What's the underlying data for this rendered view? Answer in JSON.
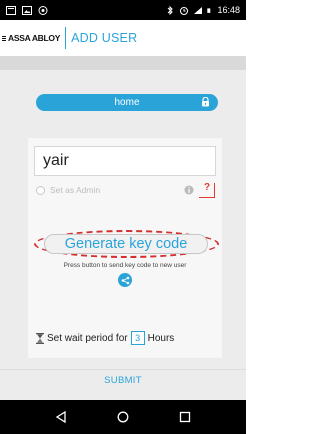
{
  "status_bar": {
    "time": "16:48"
  },
  "header": {
    "logo_text": "ASSA ABLOY",
    "title": "ADD USER"
  },
  "lock_selector": {
    "value": "home",
    "icon": "lock-icon"
  },
  "user_name": {
    "value": "yair"
  },
  "admin": {
    "label": "Set as Admin",
    "checked": false,
    "help": "?"
  },
  "generate": {
    "label": "Generate key code",
    "hint": "Press button to send key code to new user"
  },
  "wait": {
    "prefix": "Set wait period for",
    "value": "3",
    "suffix": "Hours"
  },
  "submit_label": "SUBMIT",
  "colors": {
    "accent": "#2aa4d8",
    "highlight": "#d32f2f"
  }
}
